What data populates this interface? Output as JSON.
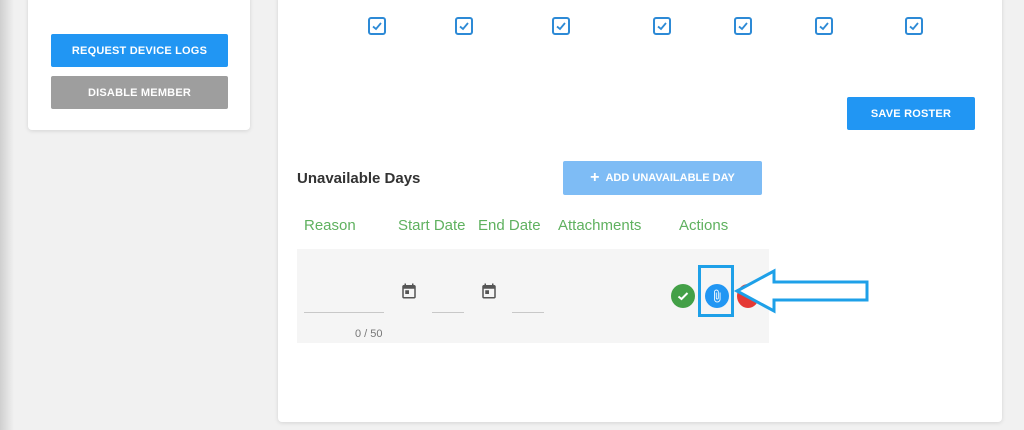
{
  "left_panel": {
    "request_logs_label": "REQUEST DEVICE LOGS",
    "disable_member_label": "DISABLE MEMBER"
  },
  "roster": {
    "checkboxes_checked": [
      true,
      true,
      true,
      true,
      true,
      true,
      true
    ],
    "save_label": "SAVE ROSTER"
  },
  "unavailable": {
    "title": "Unavailable Days",
    "add_label": "ADD UNAVAILABLE DAY",
    "columns": [
      "Reason",
      "Start Date",
      "End Date",
      "Attachments",
      "Actions"
    ],
    "reason_counter": "0 / 50"
  },
  "colors": {
    "primary": "#2196f3",
    "header_green": "#5fb15f",
    "success": "#43a047",
    "danger": "#e53935",
    "annotation": "#1ea0e8"
  },
  "icons": {
    "start_date": "calendar-icon",
    "end_date": "calendar-icon",
    "confirm": "check-icon",
    "attach": "paperclip-icon",
    "delete": "delete-icon"
  }
}
